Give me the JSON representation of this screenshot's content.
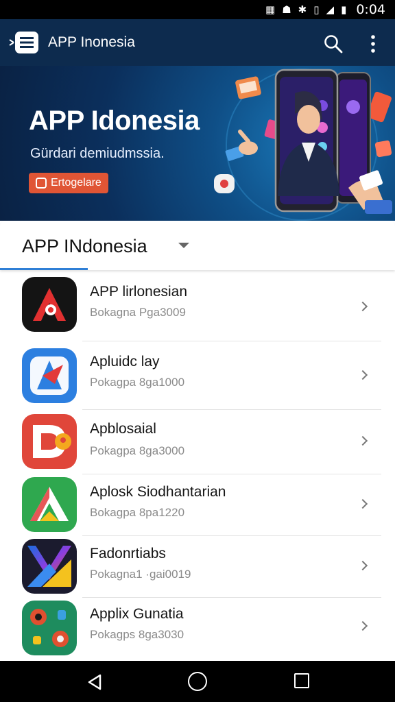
{
  "status_bar": {
    "time": "0:04",
    "icons": [
      "nfc-icon",
      "lock-badge-icon",
      "bluetooth-icon",
      "vibrate-icon",
      "signal-icon",
      "battery-icon"
    ]
  },
  "app_bar": {
    "title": "APP Inonesia",
    "icons": [
      "menu-logo-icon",
      "search-icon",
      "more-vert-icon"
    ]
  },
  "banner": {
    "title": "APP Idonesia",
    "subtitle": "Gürdari demiudmssia.",
    "button_label": "Ertogelare",
    "accent_color": "#e05535"
  },
  "category": {
    "label": "APP INdonesia",
    "accent_color": "#2f7fd6"
  },
  "apps": [
    {
      "name": "APP lirlonesian",
      "meta": "Bokagna Pga3009",
      "icon": "app-icon-red-a"
    },
    {
      "name": "Apluidc lay",
      "meta": "Pokagpa 8ga1000",
      "icon": "app-icon-blue-star"
    },
    {
      "name": "Apblosaial",
      "meta": "Pokagpa 8ga3000",
      "icon": "app-icon-red-d"
    },
    {
      "name": "Aplosk Siodhantarian",
      "meta": "Bokagpa 8pa1220",
      "icon": "app-icon-green-a"
    },
    {
      "name": "Fadonrtiabs",
      "meta": "Pokagna1 ·gai0019",
      "icon": "app-icon-gradient"
    },
    {
      "name": "Applix Gunatia",
      "meta": "Pokagps 8ga3030",
      "icon": "app-icon-teal-dots"
    }
  ],
  "nav_bar": {
    "icons": [
      "back-icon",
      "home-icon",
      "recents-icon"
    ]
  }
}
